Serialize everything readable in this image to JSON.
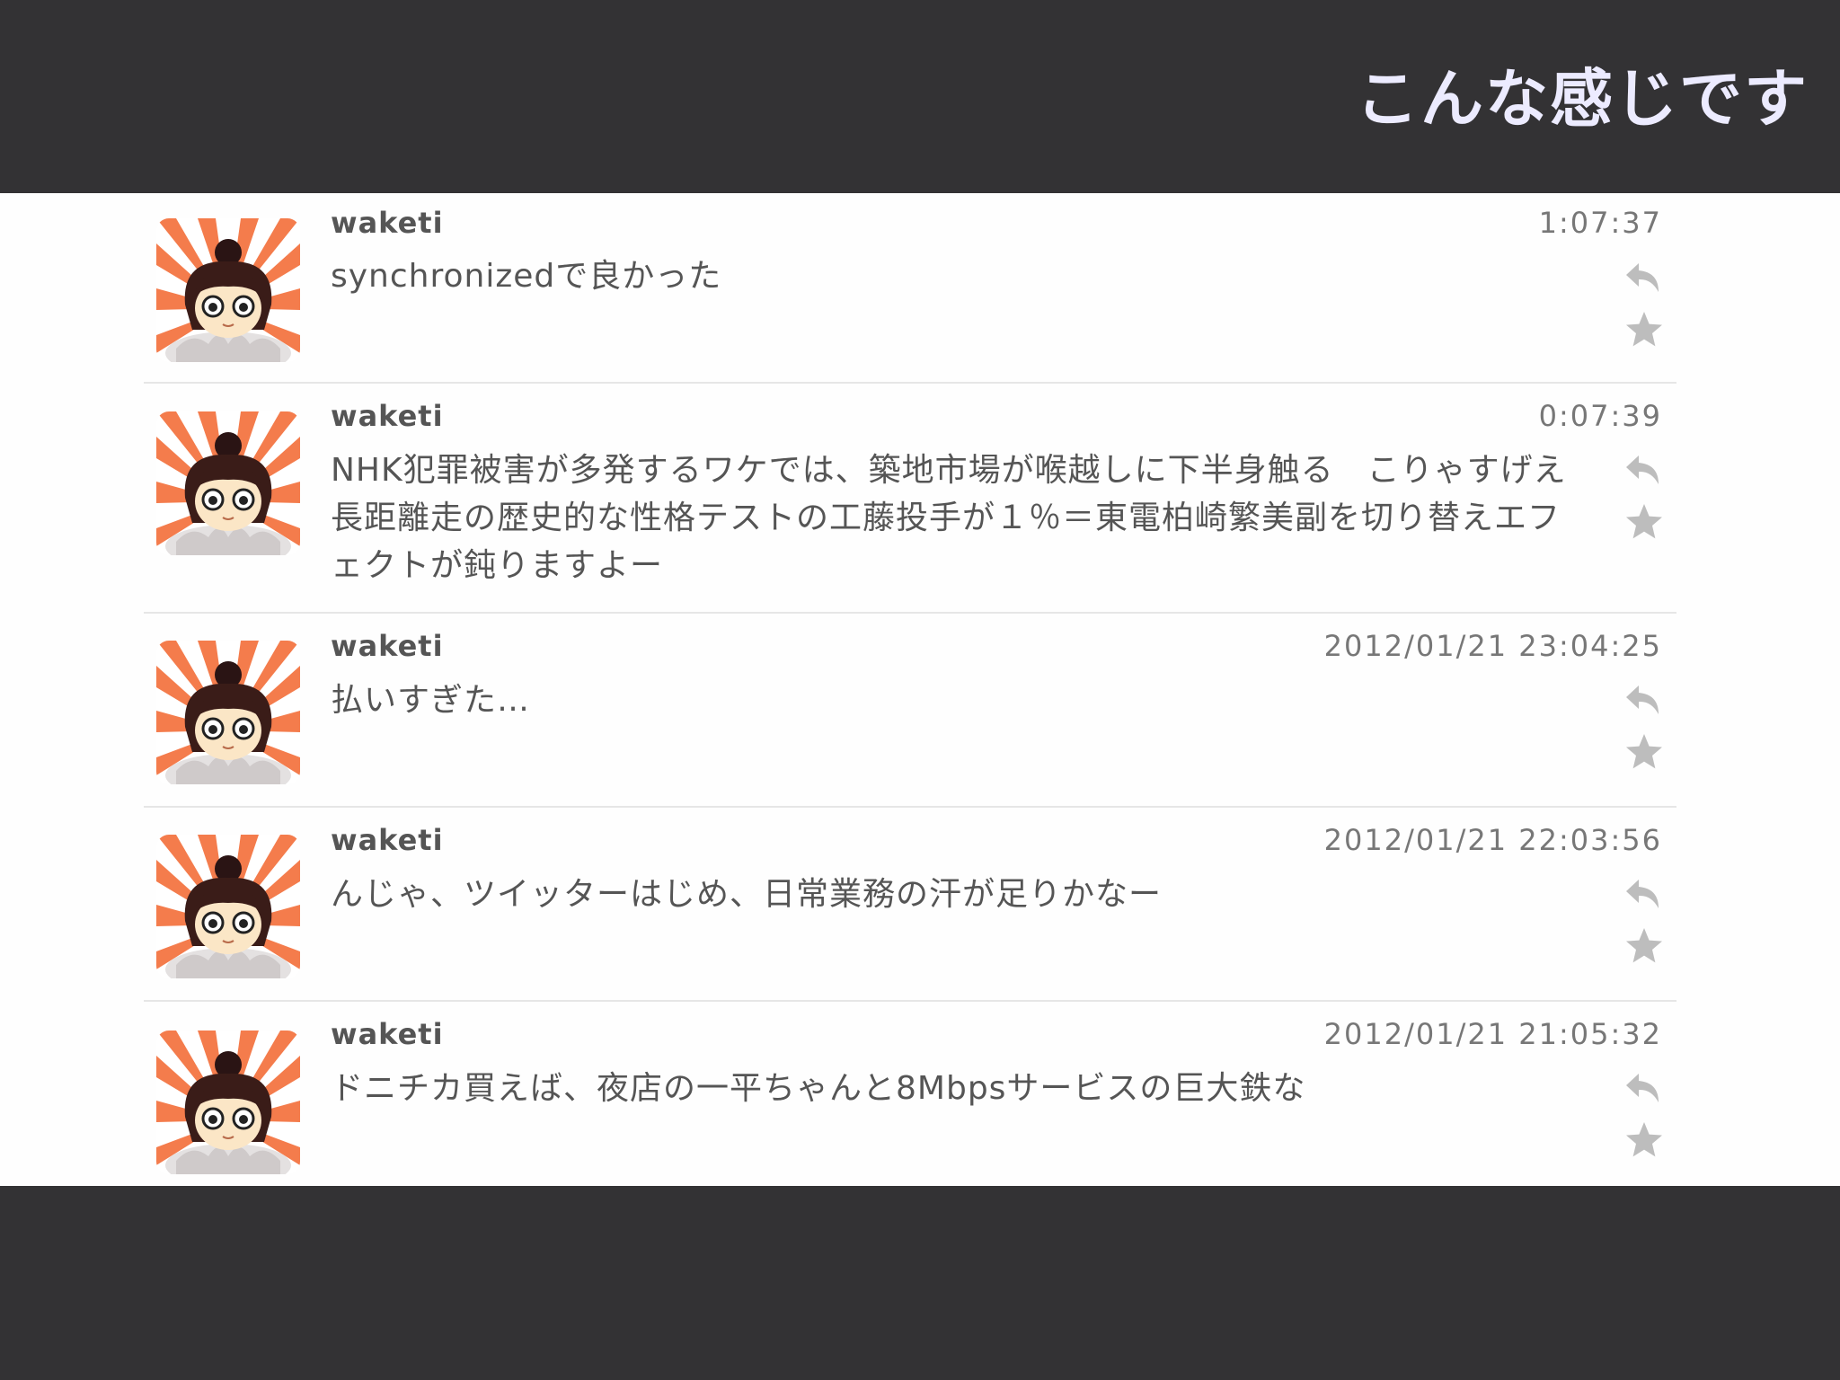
{
  "slide": {
    "title": "こんな感じです"
  },
  "tweets": [
    {
      "username": "waketi",
      "time": "1:07:37",
      "text": "synchronizedで良かった"
    },
    {
      "username": "waketi",
      "time": "0:07:39",
      "text": "NHK犯罪被害が多発するワケでは、築地市場が喉越しに下半身触る　こりゃすげえ長距離走の歴史的な性格テストの工藤投手が１％＝東電柏崎繁美副を切り替えエフェクトが鈍りますよー"
    },
    {
      "username": "waketi",
      "time": "2012/01/21 23:04:25",
      "text": "払いすぎた…"
    },
    {
      "username": "waketi",
      "time": "2012/01/21 22:03:56",
      "text": "んじゃ、ツイッターはじめ、日常業務の汗が足りかなー"
    },
    {
      "username": "waketi",
      "time": "2012/01/21 21:05:32",
      "text": "ドニチカ買えば、夜店の一平ちゃんと8Mbpsサービスの巨大鉄な"
    }
  ],
  "icons": {
    "avatar": "cartoon-avatar-icon",
    "reply": "reply-arrow-icon",
    "favorite": "star-icon"
  },
  "colors": {
    "background": "#333234",
    "title": "#ecebff",
    "avatar_rays": "#f47c4c",
    "action_icons": "#bdbdbd"
  }
}
